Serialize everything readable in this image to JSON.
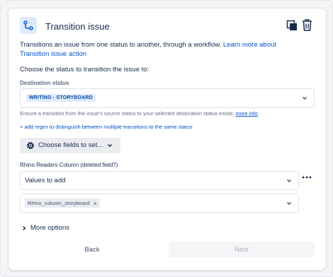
{
  "header": {
    "title": "Transition issue",
    "icon": "transition-icon",
    "actions": [
      "copy-icon",
      "trash-icon"
    ]
  },
  "description": {
    "text": "Transitions an issue from one status to another, through a workflow. ",
    "link": "Learn more about Transition issue action"
  },
  "choose_label": "Choose the status to transition the issue to:",
  "destination": {
    "label": "Destination status",
    "value": "WRITING - STORYBOARD"
  },
  "ensure": {
    "text": "Ensure a transition from the issue's source status to your selected destination status exists; ",
    "link": "more info",
    "suffix": "."
  },
  "regex_link": "+ add regex to distinguish between multiple transitions to the same status",
  "choose_fields_button": "Choose fields to set...",
  "field": {
    "label": "Rhino Readers Column (deleted field?)",
    "values_placeholder": "Values to add",
    "selected_tag": "Rhino_column_storyboard"
  },
  "more_options": "More options",
  "footer": {
    "back": "Back",
    "next": "Next"
  },
  "colors": {
    "link": "#0052cc",
    "lozenge_bg": "#deebff",
    "lozenge_text": "#0747a6",
    "disabled_bg": "#f4f5f7"
  }
}
